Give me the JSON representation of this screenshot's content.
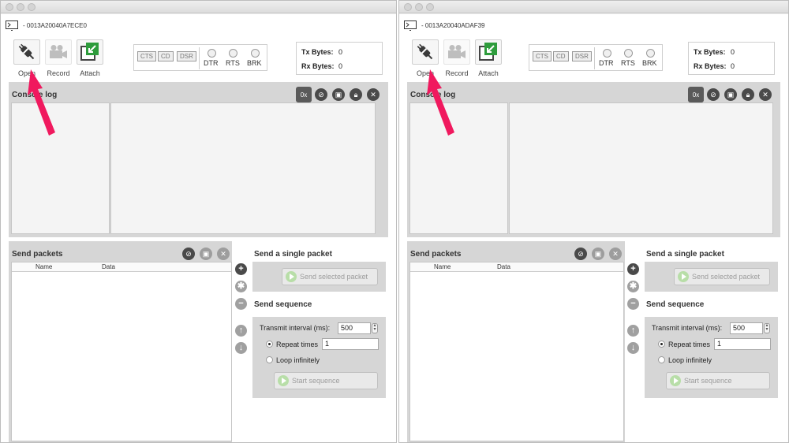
{
  "colors": {
    "accent_pink": "#f0195e",
    "play_green": "#b8dea8",
    "panel_gray": "#d6d6d6"
  },
  "windows": [
    {
      "id": "left",
      "device_title": "- 0013A20040A7ECE0",
      "toolbar": {
        "open_label": "Open",
        "record_label": "Record",
        "attach_label": "Attach",
        "lines": {
          "cts": "CTS",
          "cd": "CD",
          "dsr": "DSR",
          "dtr": "DTR",
          "rts": "RTS",
          "brk": "BRK"
        },
        "tx_label": "Tx Bytes:",
        "tx_value": "0",
        "rx_label": "Rx Bytes:",
        "rx_value": "0"
      },
      "console": {
        "title": "Console log",
        "hex_label": "0x"
      },
      "send_packets": {
        "title": "Send packets",
        "col_name": "Name",
        "col_data": "Data",
        "single_title": "Send a single packet",
        "send_selected": "Send selected packet",
        "sequence_title": "Send sequence",
        "interval_label": "Transmit interval (ms):",
        "interval_value": "500",
        "repeat_label": "Repeat times",
        "repeat_value": "1",
        "loop_label": "Loop infinitely",
        "start_label": "Start sequence"
      }
    },
    {
      "id": "right",
      "device_title": "- 0013A20040ADAF39",
      "toolbar": {
        "open_label": "Open",
        "record_label": "Record",
        "attach_label": "Attach",
        "lines": {
          "cts": "CTS",
          "cd": "CD",
          "dsr": "DSR",
          "dtr": "DTR",
          "rts": "RTS",
          "brk": "BRK"
        },
        "tx_label": "Tx Bytes:",
        "tx_value": "0",
        "rx_label": "Rx Bytes:",
        "rx_value": "0"
      },
      "console": {
        "title": "Console log",
        "hex_label": "0x"
      },
      "send_packets": {
        "title": "Send packets",
        "col_name": "Name",
        "col_data": "Data",
        "single_title": "Send a single packet",
        "send_selected": "Send selected packet",
        "sequence_title": "Send sequence",
        "interval_label": "Transmit interval (ms):",
        "interval_value": "500",
        "repeat_label": "Repeat times",
        "repeat_value": "1",
        "loop_label": "Loop infinitely",
        "start_label": "Start sequence"
      }
    }
  ]
}
